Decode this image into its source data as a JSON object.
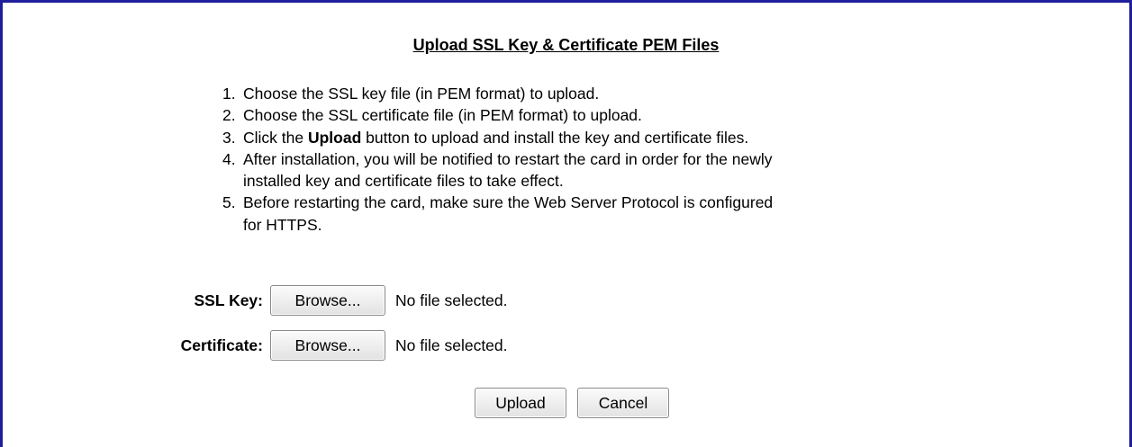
{
  "form": {
    "title": "Upload SSL Key & Certificate PEM Files",
    "steps": [
      {
        "num": "1.",
        "line1": "Choose the SSL key file (in PEM format) to upload."
      },
      {
        "num": "2.",
        "line1": "Choose the SSL certificate file (in PEM format) to upload."
      },
      {
        "num": "3.",
        "pre": "Click the ",
        "bold": "Upload",
        "post": " button to upload and install the key and certificate files."
      },
      {
        "num": "4.",
        "line1": "After installation, you will be notified to restart the card in order for the newly",
        "line2": "installed key and certificate files to take effect."
      },
      {
        "num": "5.",
        "line1": "Before restarting the card, make sure the Web Server Protocol is configured",
        "line2": "for HTTPS."
      }
    ],
    "ssl_key": {
      "label": "SSL Key:",
      "browse_label": "Browse...",
      "status": "No file selected."
    },
    "certificate": {
      "label": "Certificate:",
      "browse_label": "Browse...",
      "status": "No file selected."
    },
    "upload_label": "Upload",
    "cancel_label": "Cancel"
  },
  "colors": {
    "frame_border": "#1f1f9c",
    "background": "#ffffff"
  }
}
